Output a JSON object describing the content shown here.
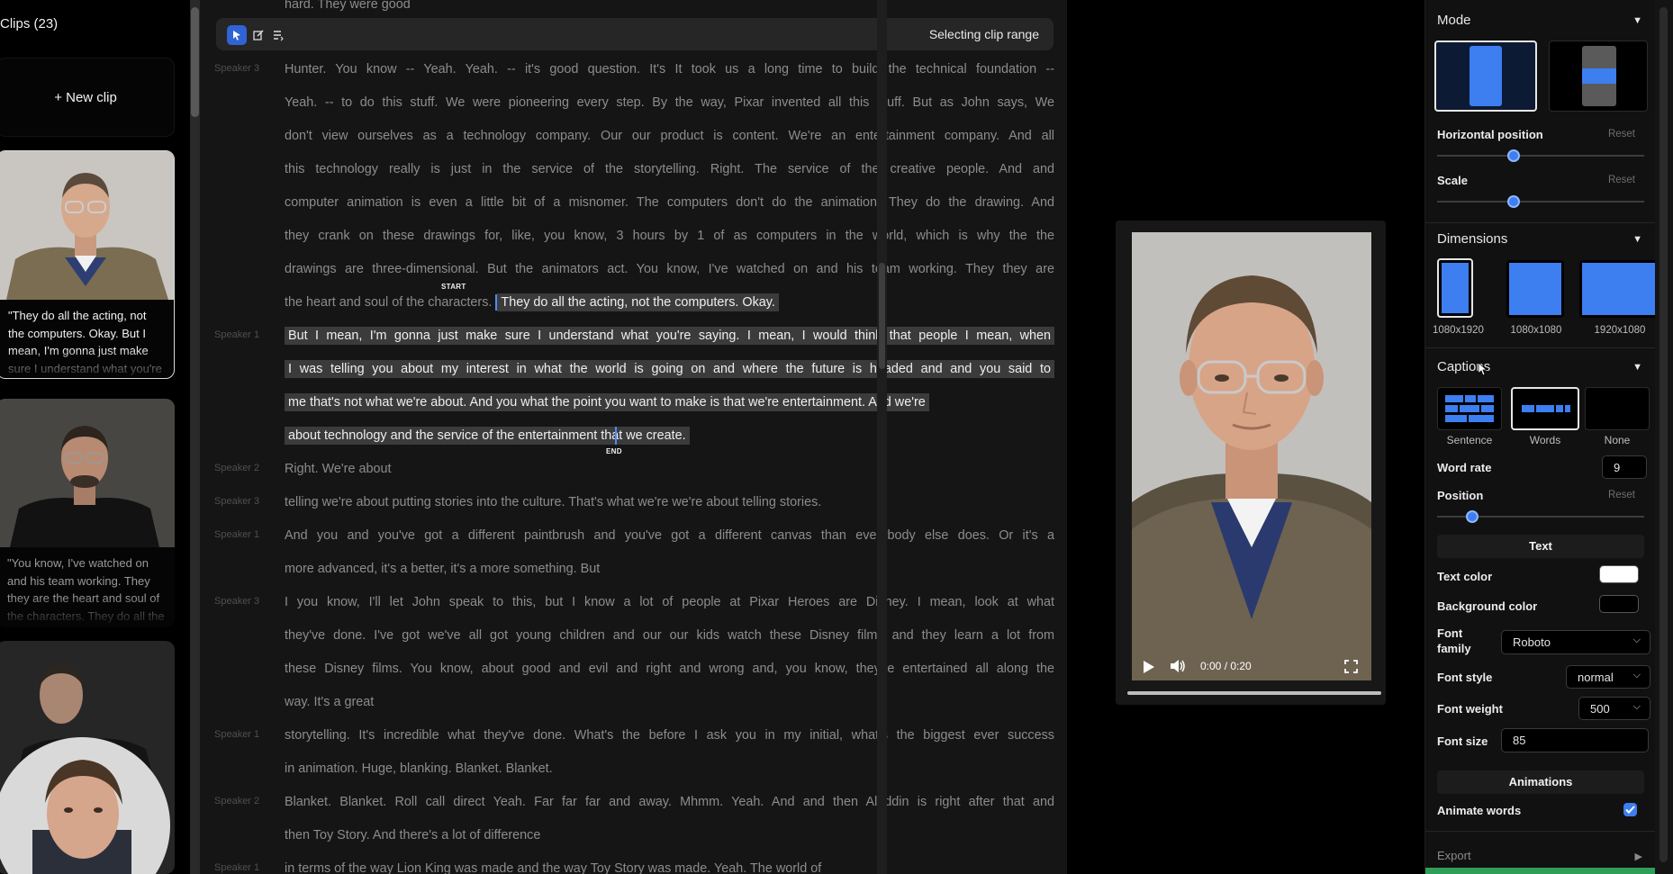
{
  "clips": {
    "title": "Clips (23)",
    "new_clip_label": "+ New clip",
    "items": [
      {
        "caption": "\"They do all the acting, not the computers. Okay. But I mean, I'm gonna just make sure I understand what you're saying. I mean, I"
      },
      {
        "caption": "\"You know, I've watched on and his team working. They they are the heart and soul of the characters. They do all the acting, not the"
      },
      {
        "caption": ""
      }
    ]
  },
  "toolbar": {
    "status": "Selecting clip range"
  },
  "transcript": {
    "start_marker": "START",
    "end_marker": "END",
    "lines": [
      {
        "speaker": "",
        "text": "hard.  They  were  good"
      },
      {
        "speaker": "Speaker 3",
        "text": "Hunter. You know -- Yeah. Yeah. -- it's good question. It's It took us a long time to build the technical foundation --"
      },
      {
        "speaker": "",
        "text": "Yeah. -- to do this stuff. We were pioneering every step. By the way, Pixar invented all this stuff. But as John says, We"
      },
      {
        "speaker": "",
        "text": "don't view ourselves as a technology company. Our our product is content. We're an entertainment company. And all"
      },
      {
        "speaker": "",
        "text": "this technology really is just in the service of the storytelling. Right. The service of the creative people. And and"
      },
      {
        "speaker": "",
        "text": "computer animation is even a little bit of a misnomer. The computers don't do the animation. They do the drawing. And"
      },
      {
        "speaker": "",
        "text": "they crank on these drawings for, like, you know, 3 hours by 1 of as computers in the world, which is why the the"
      },
      {
        "speaker": "",
        "text": "drawings are three-dimensional. But the animators act. You know, I've watched on and his team working. They they are"
      },
      {
        "speaker": "",
        "text": "the heart and soul of the characters.",
        "highlight": "They do all the acting, not the computers. Okay."
      },
      {
        "speaker": "Speaker 1",
        "text": "But I mean, I'm gonna just make sure I understand what you're saying. I mean, I would think that people I mean, when"
      },
      {
        "speaker": "",
        "text": "I was telling you about my interest in what the world is going on and where the future is headed and and you said to"
      },
      {
        "speaker": "",
        "text": "me that's not what we're about. And you what the point you want to make is that we're entertainment. And we're"
      },
      {
        "speaker": "",
        "text": "about technology and the service of the entertainment that we create."
      },
      {
        "speaker": "Speaker 2",
        "text": "Right. We're about"
      },
      {
        "speaker": "Speaker 3",
        "text": "telling we're about putting stories into the culture. That's what we're we're about telling stories."
      },
      {
        "speaker": "Speaker 1",
        "text": "And you and you've got a different paintbrush and you've got a different canvas than everybody else does. Or it's a"
      },
      {
        "speaker": "",
        "text": "more advanced, it's a better, it's a more something. But"
      },
      {
        "speaker": "Speaker 3",
        "text": "I you know, I'll let John speak to this, but I know a lot of people at Pixar Heroes are Disney. I mean, look at what"
      },
      {
        "speaker": "",
        "text": "they've done. I've got we've all got young children and our our kids watch these Disney films and they learn a lot from"
      },
      {
        "speaker": "",
        "text": "these Disney films. You know, about good and evil and right and wrong and, you know, they're entertained all along the"
      },
      {
        "speaker": "",
        "text": "way. It's a great"
      },
      {
        "speaker": "Speaker 1",
        "text": "storytelling. It's incredible what they've done. What's the before I ask you in my initial, what's the biggest ever success"
      },
      {
        "speaker": "",
        "text": "in animation. Huge, blanking. Blanket. Blanket."
      },
      {
        "speaker": "Speaker 2",
        "text": "Blanket. Blanket. Roll call direct Yeah. Far far far and away. Mhmm. Yeah. And and then Aladdin is right after that and"
      },
      {
        "speaker": "",
        "text": "then Toy Story. And there's a lot of difference"
      },
      {
        "speaker": "Speaker 1",
        "text": "in terms of the way Lion King was made and the way Toy Story was made. Yeah. The world of"
      }
    ]
  },
  "player": {
    "time": "0:00 / 0:20",
    "progress": 0
  },
  "settings": {
    "mode": {
      "title": "Mode"
    },
    "horizontal_position": {
      "label": "Horizontal position",
      "reset": "Reset",
      "value": 0.37
    },
    "scale": {
      "label": "Scale",
      "reset": "Reset",
      "value": 0.37
    },
    "dimensions": {
      "title": "Dimensions",
      "options": [
        "1080x1920",
        "1080x1080",
        "1920x1080"
      ]
    },
    "captions": {
      "title": "Captions",
      "options": [
        "Sentence",
        "Words",
        "None"
      ],
      "selected": "Words",
      "word_rate_label": "Word rate",
      "word_rate": "9",
      "position_label": "Position",
      "position_reset": "Reset",
      "position_value": 0.17
    },
    "text": {
      "header": "Text",
      "text_color_label": "Text color",
      "text_color": "#ffffff",
      "background_color_label": "Background color",
      "background_color": "#000000",
      "font_family_label_1": "Font",
      "font_family_label_2": "family",
      "font_family": "Roboto",
      "font_style_label": "Font style",
      "font_style": "normal",
      "font_weight_label": "Font weight",
      "font_weight": "500",
      "font_size_label": "Font size",
      "font_size": "85"
    },
    "animations": {
      "header": "Animations",
      "animate_words_label": "Animate words",
      "animate_words": true
    },
    "export": {
      "label": "Export"
    }
  },
  "colors": {
    "accent": "#3d7ef0",
    "highlight": "#3b3b3b",
    "export_green": "#2f9e58"
  }
}
